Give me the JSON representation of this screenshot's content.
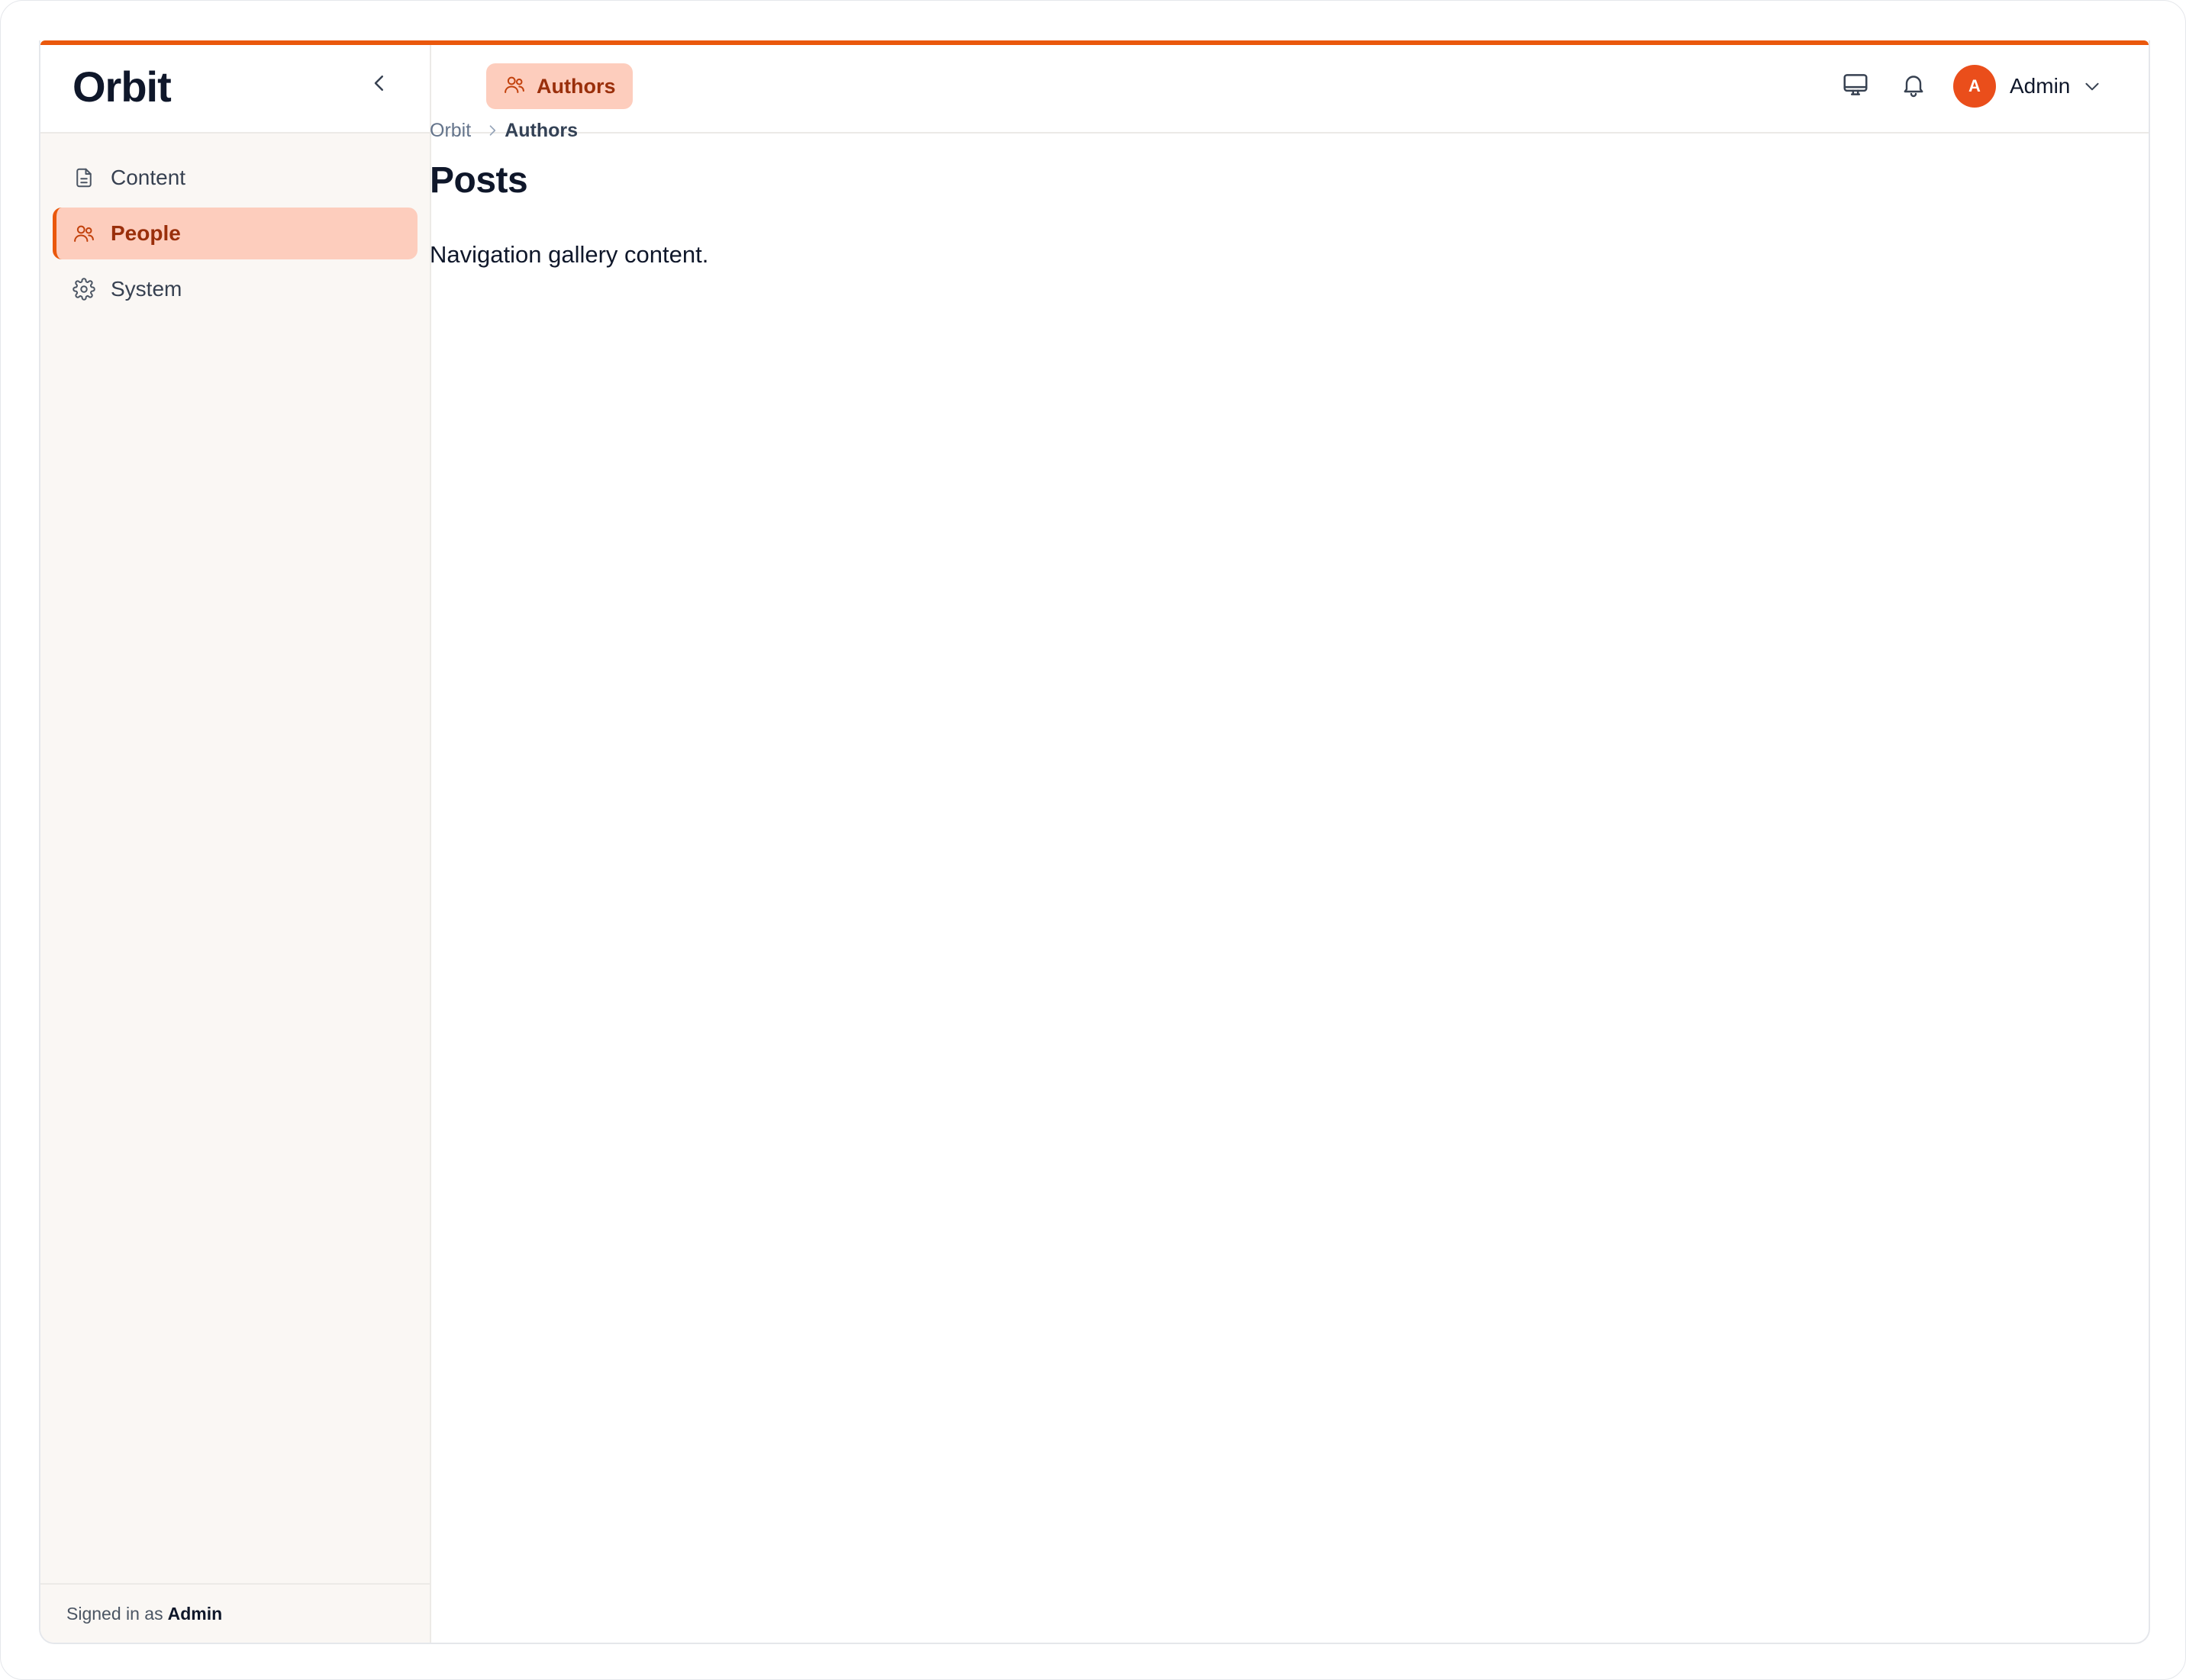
{
  "app": {
    "brand": "Orbit",
    "accent_color": "#ea580c",
    "collapse_icon": "chevron-left-icon"
  },
  "sidebar": {
    "items": [
      {
        "label": "Content",
        "icon": "document-icon",
        "active": false
      },
      {
        "label": "People",
        "icon": "users-icon",
        "active": true
      },
      {
        "label": "System",
        "icon": "gear-icon",
        "active": false
      }
    ],
    "footer": {
      "prefix": "Signed in as",
      "user": "Admin"
    }
  },
  "topbar": {
    "tab": {
      "label": "Authors",
      "icon": "users-icon"
    },
    "icons": [
      "monitor-icon",
      "bell-icon"
    ],
    "user": {
      "avatar_initial": "A",
      "name": "Admin",
      "avatar_color": "#ea4e1b"
    }
  },
  "main": {
    "breadcrumb": {
      "root": "Orbit",
      "current": "Authors"
    },
    "title": "Posts",
    "body": "Navigation gallery content."
  }
}
